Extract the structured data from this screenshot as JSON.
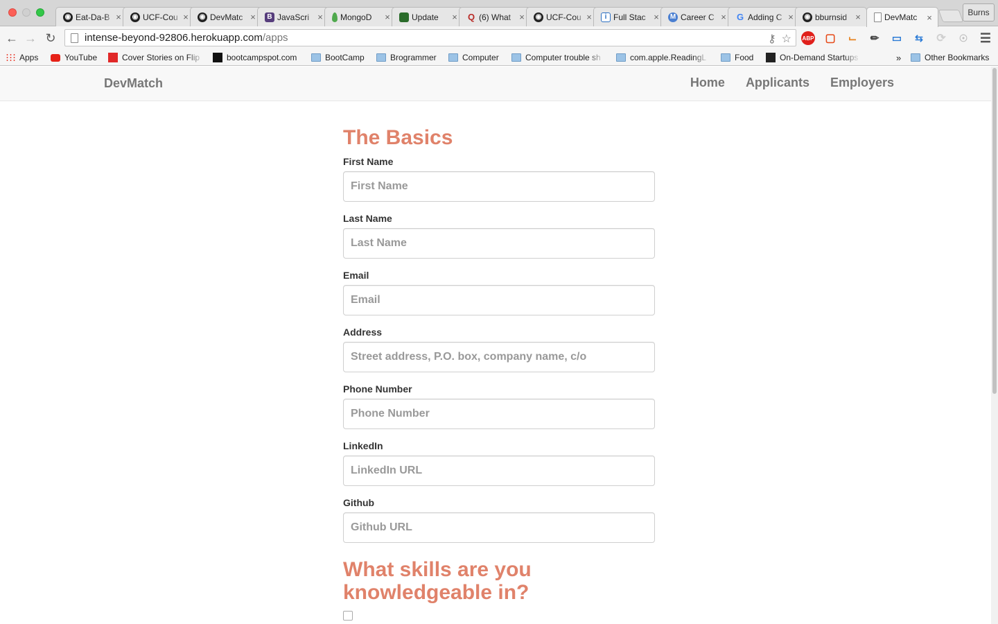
{
  "browser": {
    "tabs": [
      {
        "label": "Eat-Da-B",
        "icon": "github-icon",
        "active": false
      },
      {
        "label": "UCF-Cou",
        "icon": "github-icon",
        "active": false
      },
      {
        "label": "DevMatc",
        "icon": "github-icon",
        "active": false
      },
      {
        "label": "JavaScri",
        "icon": "bootstrap-icon",
        "active": false
      },
      {
        "label": "MongoD",
        "icon": "mongodb-leaf-icon",
        "active": false
      },
      {
        "label": "Update",
        "icon": "update-icon",
        "active": false
      },
      {
        "label": "(6) What",
        "icon": "quora-icon",
        "active": false
      },
      {
        "label": "UCF-Cou",
        "icon": "github-icon",
        "active": false
      },
      {
        "label": "Full Stac",
        "icon": "info-icon",
        "active": false
      },
      {
        "label": "Career C",
        "icon": "career-icon",
        "active": false
      },
      {
        "label": "Adding C",
        "icon": "google-icon",
        "active": false
      },
      {
        "label": "bburnsid",
        "icon": "github-icon",
        "active": false
      },
      {
        "label": "DevMatc",
        "icon": "page-icon",
        "active": true
      }
    ],
    "tab_close_glyph": "×",
    "profile_label": "Burns",
    "url_host": "intense-beyond-92806.herokuapp.com",
    "url_path": "/apps",
    "bookmarks": [
      {
        "label": "Apps",
        "icon": "apps-grid-icon"
      },
      {
        "label": "YouTube",
        "icon": "youtube-icon"
      },
      {
        "label": "Cover Stories on Flip",
        "icon": "flipboard-icon"
      },
      {
        "label": "bootcampspot.com",
        "icon": "bootcampspot-icon"
      },
      {
        "label": "BootCamp",
        "icon": "folder-icon"
      },
      {
        "label": "Brogrammer",
        "icon": "folder-icon"
      },
      {
        "label": "Computer",
        "icon": "folder-icon"
      },
      {
        "label": "Computer trouble sh",
        "icon": "folder-icon"
      },
      {
        "label": "com.apple.ReadingL",
        "icon": "folder-icon"
      },
      {
        "label": "Food",
        "icon": "folder-icon"
      },
      {
        "label": "On-Demand Startups",
        "icon": "startup-icon"
      }
    ],
    "bookmarks_overflow": "»",
    "other_bookmarks": "Other Bookmarks",
    "colors": {
      "tab_bar": "#d6d6d6",
      "toolbar": "#f5f5f5"
    }
  },
  "site": {
    "brand": "DevMatch",
    "nav": [
      "Home",
      "Applicants",
      "Employers"
    ]
  },
  "form": {
    "section_title": "The Basics",
    "fields": [
      {
        "label": "First Name",
        "placeholder": "First Name"
      },
      {
        "label": "Last Name",
        "placeholder": "Last Name"
      },
      {
        "label": "Email",
        "placeholder": "Email"
      },
      {
        "label": "Address",
        "placeholder": "Street address, P.O. box, company name, c/o"
      },
      {
        "label": "Phone Number",
        "placeholder": "Phone Number"
      },
      {
        "label": "LinkedIn",
        "placeholder": "LinkedIn URL"
      },
      {
        "label": "Github",
        "placeholder": "Github URL"
      }
    ],
    "skills_title": "What skills are you knowledgeable in?",
    "colors": {
      "heading": "#e0826a",
      "navbar_bg": "#f8f8f8"
    }
  }
}
